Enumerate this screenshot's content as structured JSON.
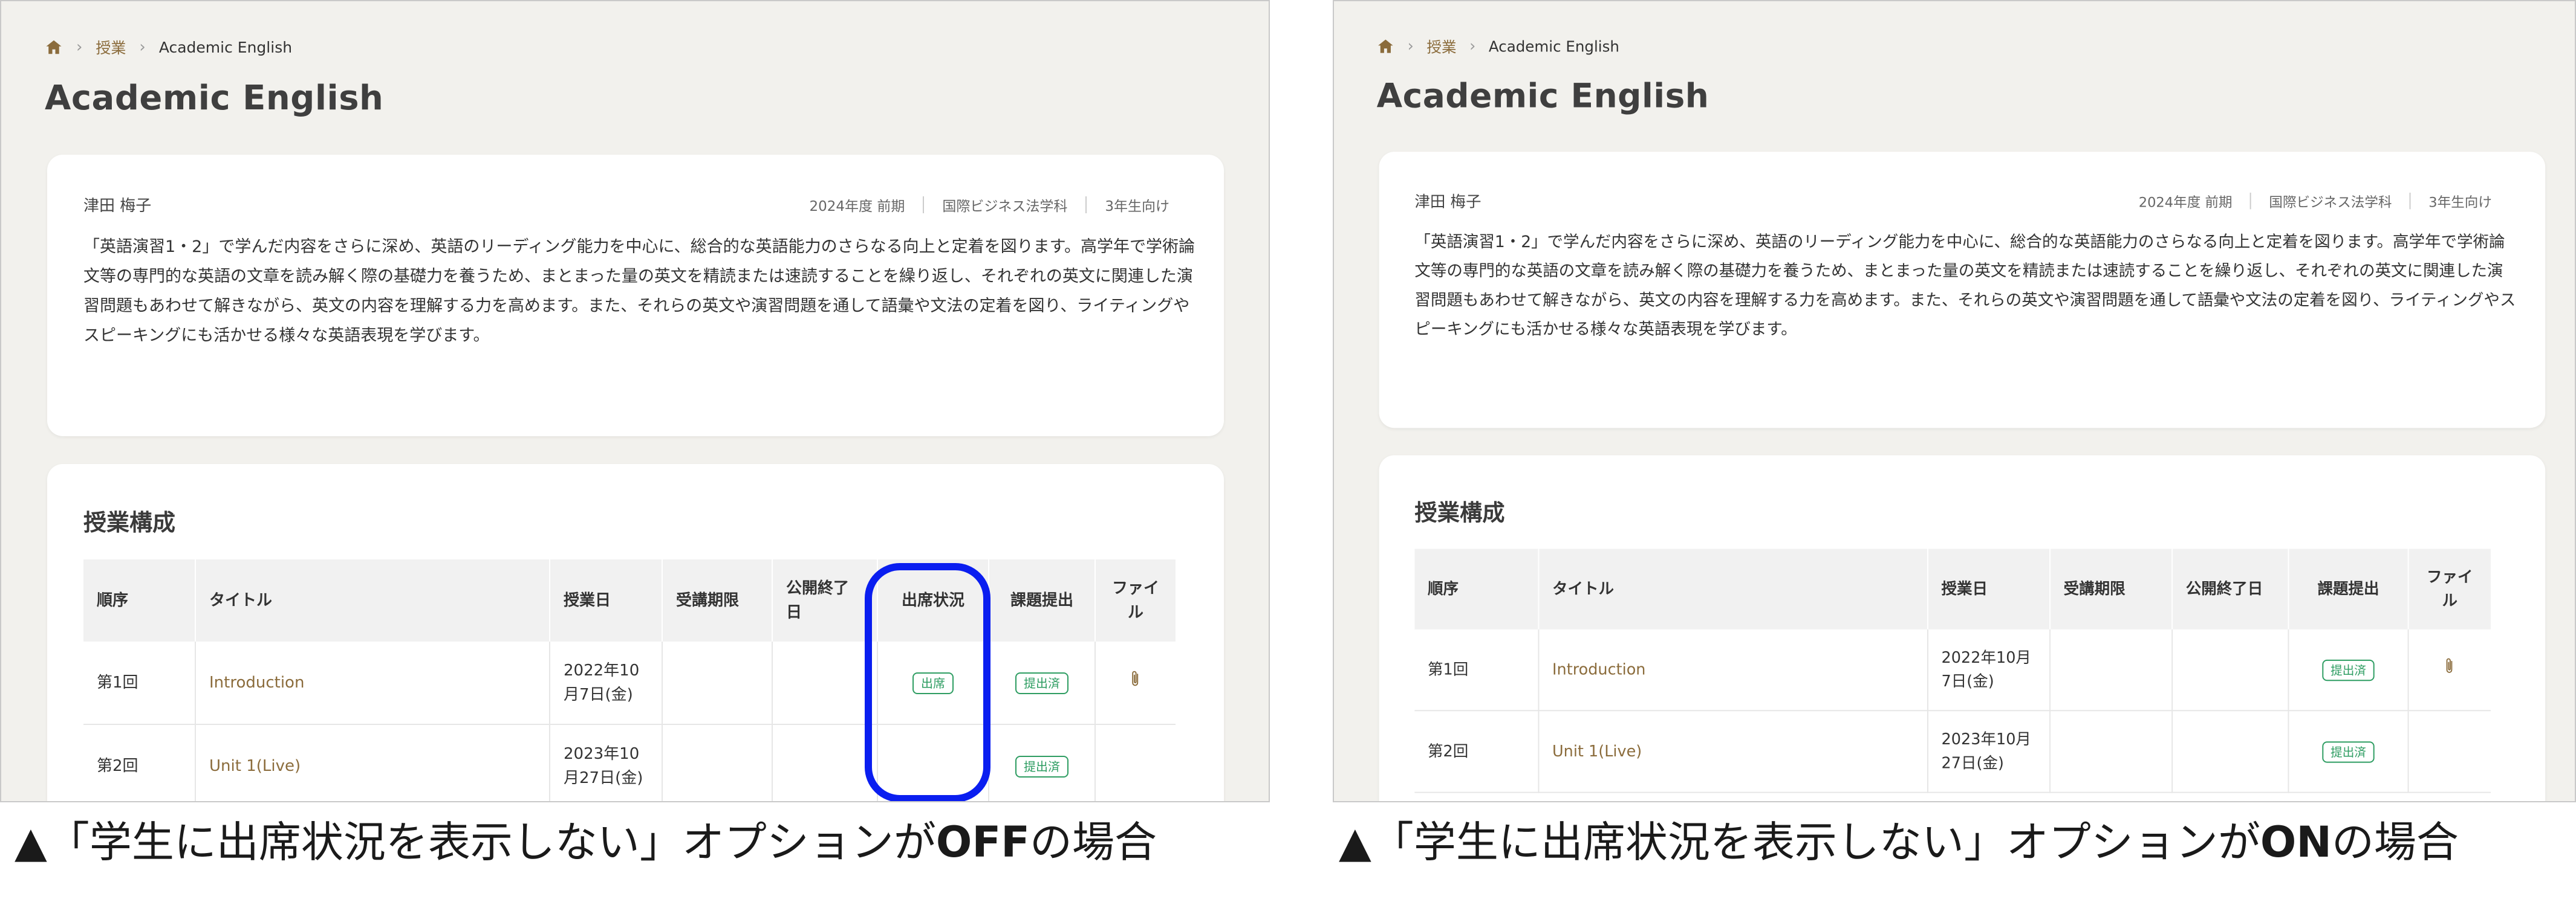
{
  "panels": [
    {
      "id": "off",
      "breadcrumb": {
        "home_icon": "home-icon",
        "parent": "授業",
        "current": "Academic English"
      },
      "page_title": "Academic English",
      "course": {
        "teacher": "津田 梅子",
        "term": "2024年度 前期",
        "department": "国際ビジネス法学科",
        "target": "3年生向け",
        "description": "「英語演習1・2」で学んだ内容をさらに深め、英語のリーディング能力を中心に、総合的な英語能力のさらなる向上と定着を図ります。高学年で学術論文等の専門的な英語の文章を読み解く際の基礎力を養うため、まとまった量の英文を精読または速読することを繰り返し、それぞれの英文に関連した演習問題もあわせて解きながら、英文の内容を理解する力を高めます。また、それらの英文や演習問題を通して語彙や文法の定着を図り、ライティングやスピーキングにも活かせる様々な英語表現を学びます。"
      },
      "structure": {
        "title": "授業構成",
        "headers": [
          "順序",
          "タイトル",
          "授業日",
          "受講期限",
          "公開終了日",
          "出席状況",
          "課題提出",
          "ファイル"
        ],
        "rows": [
          {
            "order": "第1回",
            "title": "Introduction",
            "date": "2022年10月7日(金)",
            "deadline": "",
            "close_date": "",
            "attendance": "出席",
            "submission": "提出済",
            "file_icon": "paperclip-icon"
          },
          {
            "order": "第2回",
            "title": "Unit 1(Live)",
            "date": "2023年10月27日(金)",
            "deadline": "",
            "close_date": "",
            "attendance": "",
            "submission": "提出済",
            "file_icon": ""
          }
        ]
      },
      "caption": {
        "prefix": "▲「学生に出席状況を表示しない」オプションが",
        "emphasis": "OFF",
        "suffix": "の場合"
      }
    },
    {
      "id": "on",
      "breadcrumb": {
        "home_icon": "home-icon",
        "parent": "授業",
        "current": "Academic English"
      },
      "page_title": "Academic English",
      "course": {
        "teacher": "津田 梅子",
        "term": "2024年度 前期",
        "department": "国際ビジネス法学科",
        "target": "3年生向け",
        "description": "「英語演習1・2」で学んだ内容をさらに深め、英語のリーディング能力を中心に、総合的な英語能力のさらなる向上と定着を図ります。高学年で学術論文等の専門的な英語の文章を読み解く際の基礎力を養うため、まとまった量の英文を精読または速読することを繰り返し、それぞれの英文に関連した演習問題もあわせて解きながら、英文の内容を理解する力を高めます。また、それらの英文や演習問題を通して語彙や文法の定着を図り、ライティングやスピーキングにも活かせる様々な英語表現を学びます。"
      },
      "structure": {
        "title": "授業構成",
        "headers": [
          "順序",
          "タイトル",
          "授業日",
          "受講期限",
          "公開終了日",
          "課題提出",
          "ファイル"
        ],
        "rows": [
          {
            "order": "第1回",
            "title": "Introduction",
            "date": "2022年10月7日(金)",
            "deadline": "",
            "close_date": "",
            "submission": "提出済",
            "file_icon": "paperclip-icon"
          },
          {
            "order": "第2回",
            "title": "Unit 1(Live)",
            "date": "2023年10月27日(金)",
            "deadline": "",
            "close_date": "",
            "submission": "提出済",
            "file_icon": ""
          }
        ]
      },
      "caption": {
        "prefix": "▲「学生に出席状況を表示しない」オプションが",
        "emphasis": "ON",
        "suffix": "の場合"
      }
    }
  ],
  "colors": {
    "accent_brown": "#8b6c3c",
    "success_green": "#2e9d62",
    "highlight_blue": "#0a1ef0",
    "page_bg": "#f2f1ed"
  }
}
